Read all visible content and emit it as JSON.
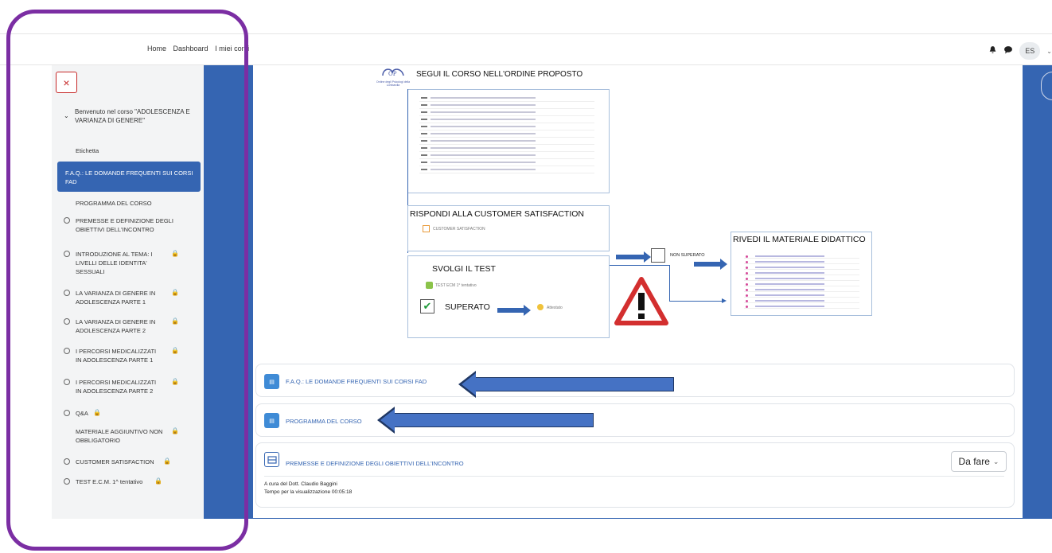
{
  "topbar": {
    "nav": [
      "Home",
      "Dashboard",
      "I miei corsi"
    ],
    "user_initials": "ES"
  },
  "sidebar": {
    "close_label": "×",
    "course_title": "Benvenuto nel corso \"ADOLESCENZA E VARIANZA DI GENERE\"",
    "items": [
      {
        "label": "Etichetta"
      },
      {
        "label": "F.A.Q.: LE DOMANDE FREQUENTI SUI CORSI FAD"
      },
      {
        "label": "PROGRAMMA DEL CORSO"
      },
      {
        "label": "PREMESSE E DEFINIZIONE DEGLI OBIETTIVI DELL'INCONTRO"
      },
      {
        "label": "INTRODUZIONE AL TEMA: I LIVELLI DELLE IDENTITA' SESSUALI"
      },
      {
        "label": "LA VARIANZA DI GENERE IN ADOLESCENZA PARTE 1"
      },
      {
        "label": "LA VARIANZA DI GENERE IN ADOLESCENZA PARTE 2"
      },
      {
        "label": "I PERCORSI MEDICALIZZATI IN ADOLESCENZA PARTE 1"
      },
      {
        "label": "I PERCORSI MEDICALIZZATI IN ADOLESCENZA PARTE 2"
      },
      {
        "label": "Q&A"
      },
      {
        "label": "MATERIALE AGGIUNTIVO NON OBBLIGATORIO"
      },
      {
        "label": "CUSTOMER SATISFACTION"
      },
      {
        "label": "TEST E.C.M. 1^ tentativo"
      }
    ]
  },
  "diagram": {
    "logo_text": "Ordine degli Psicologi della Lombardia",
    "title": "SEGUI IL CORSO NELL'ORDINE PROPOSTO",
    "customer_title": "RISPONDI ALLA CUSTOMER SATISFACTION",
    "customer_sub": "CUSTOMER SATISFACTION",
    "test_title": "SVOLGI IL TEST",
    "test_sub": "TEST ECM 1° tentativo",
    "superato": "SUPERATO",
    "attestato": "Attestato",
    "non_superato": "NON SUPERATO",
    "review_title": "RIVEDI IL MATERIALE DIDATTICO"
  },
  "cards": [
    {
      "title": "F.A.Q.: LE DOMANDE FREQUENTI SUI CORSI FAD"
    },
    {
      "title": "PROGRAMMA DEL CORSO"
    },
    {
      "title": "PREMESSE E DEFINIZIONE DEGLI OBIETTIVI DELL'INCONTRO",
      "status": "Da fare",
      "author": "A cura del Dott. Claudio Baggini",
      "time": "Tempo per la visualizzazione 00:05:18"
    }
  ],
  "colors": {
    "primary": "#3565b2",
    "frame": "#7b2ea3",
    "danger": "#c62828"
  }
}
